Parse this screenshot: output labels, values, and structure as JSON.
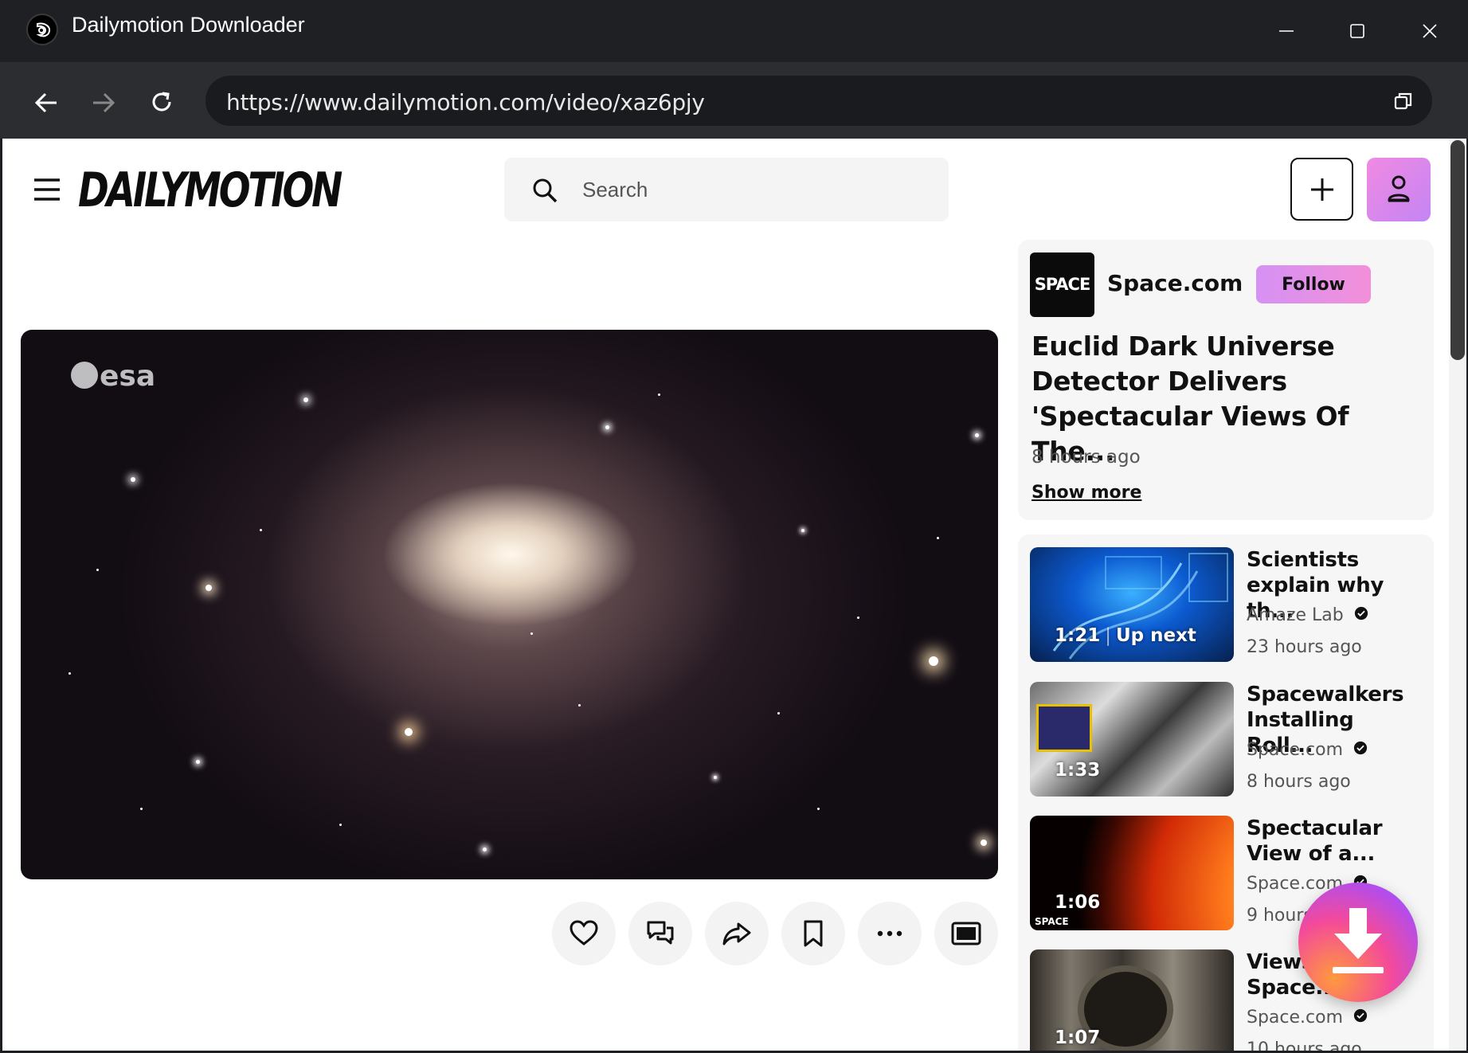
{
  "window": {
    "title": "Dailymotion Downloader",
    "icon": "dailymotion-app-icon"
  },
  "browser": {
    "url": "https://www.dailymotion.com/video/xaz6pjy"
  },
  "header": {
    "logo": "DAILYMOTION",
    "search_placeholder": "Search"
  },
  "player": {
    "watermark": "esa"
  },
  "video_info": {
    "channel_avatar_text": "SPACE",
    "channel_name": "Space.com",
    "follow_label": "Follow",
    "title": "Euclid Dark Universe Detector Delivers 'Spectacular Views Of The...",
    "time_ago": "8 hours ago",
    "show_more": "Show more"
  },
  "recommendations": [
    {
      "duration": "1:21",
      "badge": "Up next",
      "title": "Scientists explain why th...",
      "channel": "Amaze Lab",
      "time_ago": "23 hours ago"
    },
    {
      "duration": "1:33",
      "title": "Spacewalkers Installing Roll...",
      "channel": "Space.com",
      "time_ago": "8 hours ago"
    },
    {
      "duration": "1:06",
      "thumb_brand": "SPACE",
      "title": "Spectacular View of a...",
      "channel": "Space.com",
      "time_ago": "9 hours ago"
    },
    {
      "duration": "1:07",
      "title": "Views Of A Space...",
      "channel": "Space.com",
      "time_ago": "10 hours ago"
    }
  ],
  "colors": {
    "accent_gradient_start": "#d591f4",
    "accent_gradient_end": "#f38fd9",
    "titlebar": "#1e2024"
  }
}
